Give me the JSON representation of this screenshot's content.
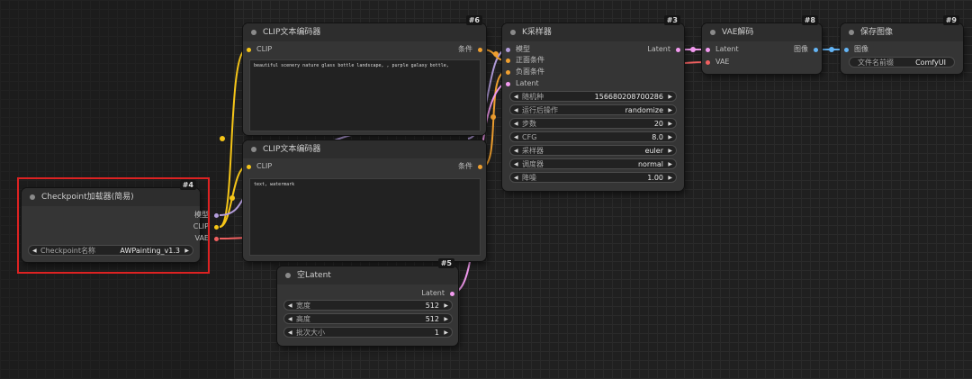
{
  "canvas": {
    "background": "#202020"
  },
  "colors": {
    "clip": "#f5c518",
    "conditioning": "#f0a030",
    "model": "#b39ddb",
    "latent": "#f39bf0",
    "vae": "#f06060",
    "image": "#64b5f6",
    "highlight": "#dd2222"
  },
  "nodes": {
    "checkpoint": {
      "id": "#4",
      "title": "Checkpoint加载器(简易)",
      "outputs": [
        "模型",
        "CLIP",
        "VAE"
      ],
      "widget": {
        "label": "Checkpoint名称",
        "value": "AWPainting_v1.3"
      }
    },
    "clip_pos": {
      "id": "#6",
      "title": "CLIP文本编码器",
      "input": "CLIP",
      "output": "条件",
      "text": "beautiful scenery nature glass bottle landscape, , purple galaxy bottle,"
    },
    "clip_neg": {
      "id": "",
      "title": "CLIP文本编码器",
      "input": "CLIP",
      "output": "条件",
      "text": "text, watermark"
    },
    "empty_latent": {
      "id": "#5",
      "title": "空Latent",
      "output": "Latent",
      "widgets": [
        {
          "label": "宽度",
          "value": "512"
        },
        {
          "label": "高度",
          "value": "512"
        },
        {
          "label": "批次大小",
          "value": "1"
        }
      ]
    },
    "ksampler": {
      "id": "#3",
      "title": "K采样器",
      "inputs": [
        "模型",
        "正面条件",
        "负面条件",
        "Latent"
      ],
      "output": "Latent",
      "widgets": [
        {
          "label": "随机种",
          "value": "156680208700286"
        },
        {
          "label": "运行后操作",
          "value": "randomize"
        },
        {
          "label": "步数",
          "value": "20"
        },
        {
          "label": "CFG",
          "value": "8.0"
        },
        {
          "label": "采样器",
          "value": "euler"
        },
        {
          "label": "调度器",
          "value": "normal"
        },
        {
          "label": "降噪",
          "value": "1.00"
        }
      ]
    },
    "vae_decode": {
      "id": "#8",
      "title": "VAE解码",
      "inputs": [
        "Latent",
        "VAE"
      ],
      "output": "图像"
    },
    "save_image": {
      "id": "#9",
      "title": "保存图像",
      "input": "图像",
      "widget": {
        "label": "文件名前缀",
        "value": "ComfyUI"
      }
    }
  }
}
